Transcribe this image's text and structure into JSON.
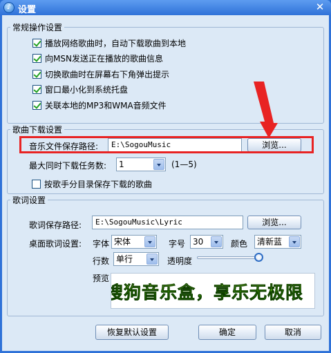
{
  "window": {
    "title": "设置",
    "app_icon_glyph": "♪",
    "close_glyph": "✕"
  },
  "general": {
    "legend": "常规操作设置",
    "options": [
      {
        "label": "播放网络歌曲时，自动下载歌曲到本地",
        "checked": true
      },
      {
        "label": "向MSN发送正在播放的歌曲信息",
        "checked": true
      },
      {
        "label": "切换歌曲时在屏幕右下角弹出提示",
        "checked": true
      },
      {
        "label": "窗口最小化到系统托盘",
        "checked": true
      },
      {
        "label": "关联本地的MP3和WMA音频文件",
        "checked": true
      }
    ]
  },
  "download": {
    "legend": "歌曲下载设置",
    "path_label": "音乐文件保存路径:",
    "path_value": "E:\\SogouMusic",
    "browse_label": "浏览...",
    "max_tasks_label": "最大同时下载任务数:",
    "max_tasks_value": "1",
    "max_tasks_range": "(1—5)",
    "by_artist_label": "按歌手分目录保存下载的歌曲",
    "by_artist_checked": false
  },
  "lyrics": {
    "legend": "歌词设置",
    "path_label": "歌词保存路径:",
    "path_value": "E:\\SogouMusic\\Lyric",
    "browse_label": "浏览...",
    "desktop_label": "桌面歌词设置:",
    "font_label": "字体",
    "font_value": "宋体",
    "size_label": "字号",
    "size_value": "30",
    "color_label": "颜色",
    "color_value": "清新蓝",
    "lines_label": "行数",
    "lines_value": "单行",
    "opacity_label": "透明度",
    "opacity_level": 1.0,
    "preview_label": "预览",
    "preview_text": "搜狗音乐盒，享乐无极限"
  },
  "footer": {
    "restore_label": "恢复默认设置",
    "ok_label": "确定",
    "cancel_label": "取消"
  },
  "colors": {
    "annotation": "#e82323",
    "title_bar": "#2f72d8",
    "client_bg": "#dce9f6"
  }
}
